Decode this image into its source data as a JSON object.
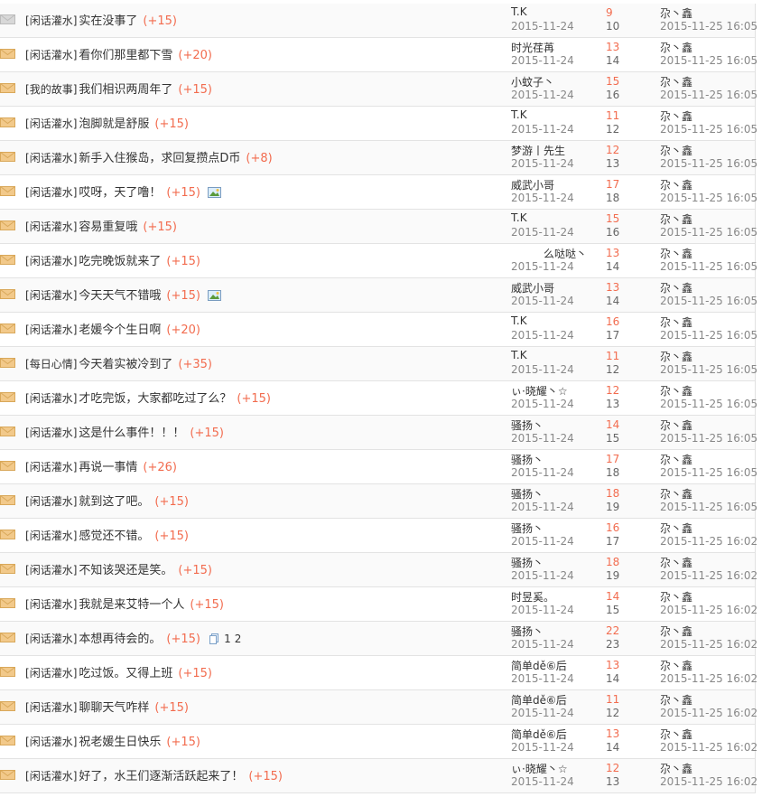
{
  "rows": [
    {
      "category": "闲话灌水",
      "title": "实在没事了",
      "reward": "+15",
      "author": "T.K",
      "date": "2015-11-24",
      "replies": "9",
      "views": "10",
      "last_user": "尕丶鑫",
      "last_time": "2015-11-25 16:05",
      "icon": "read"
    },
    {
      "category": "闲话灌水",
      "title": "看你们那里都下雪",
      "reward": "+20",
      "author": "时光荏苒",
      "date": "2015-11-24",
      "replies": "13",
      "views": "14",
      "last_user": "尕丶鑫",
      "last_time": "2015-11-25 16:05",
      "icon": "new"
    },
    {
      "category": "我的故事",
      "title": "我们相识两周年了",
      "reward": "+15",
      "author": "小蚊子丶",
      "date": "2015-11-24",
      "replies": "15",
      "views": "16",
      "last_user": "尕丶鑫",
      "last_time": "2015-11-25 16:05",
      "icon": "new"
    },
    {
      "category": "闲话灌水",
      "title": "泡脚就是舒服",
      "reward": "+15",
      "author": "T.K",
      "date": "2015-11-24",
      "replies": "11",
      "views": "12",
      "last_user": "尕丶鑫",
      "last_time": "2015-11-25 16:05",
      "icon": "new"
    },
    {
      "category": "闲话灌水",
      "title": "新手入住猴岛，求回复攒点D币",
      "reward": "+8",
      "author": "梦游丨先生",
      "date": "2015-11-24",
      "replies": "12",
      "views": "13",
      "last_user": "尕丶鑫",
      "last_time": "2015-11-25 16:05",
      "icon": "new"
    },
    {
      "category": "闲话灌水",
      "title": "哎呀，天了噜！",
      "reward": "+15",
      "author": "威武小哥",
      "date": "2015-11-24",
      "replies": "17",
      "views": "18",
      "last_user": "尕丶鑫",
      "last_time": "2015-11-25 16:05",
      "icon": "new",
      "has_image": true
    },
    {
      "category": "闲话灌水",
      "title": "容易重复哦",
      "reward": "+15",
      "author": "T.K",
      "date": "2015-11-24",
      "replies": "15",
      "views": "16",
      "last_user": "尕丶鑫",
      "last_time": "2015-11-25 16:05",
      "icon": "new"
    },
    {
      "category": "闲话灌水",
      "title": "吃完晚饭就来了",
      "reward": "+15",
      "author": "么哒哒丶",
      "date": "2015-11-24",
      "replies": "13",
      "views": "14",
      "last_user": "尕丶鑫",
      "last_time": "2015-11-25 16:05",
      "icon": "new",
      "author_shift": true
    },
    {
      "category": "闲话灌水",
      "title": "今天天气不错哦",
      "reward": "+15",
      "author": "威武小哥",
      "date": "2015-11-24",
      "replies": "13",
      "views": "14",
      "last_user": "尕丶鑫",
      "last_time": "2015-11-25 16:05",
      "icon": "new",
      "has_image": true
    },
    {
      "category": "闲话灌水",
      "title": "老媛今个生日啊",
      "reward": "+20",
      "author": "T.K",
      "date": "2015-11-24",
      "replies": "16",
      "views": "17",
      "last_user": "尕丶鑫",
      "last_time": "2015-11-25 16:05",
      "icon": "new"
    },
    {
      "category": "每日心情",
      "title": "今天着实被冷到了",
      "reward": "+35",
      "author": "T.K",
      "date": "2015-11-24",
      "replies": "11",
      "views": "12",
      "last_user": "尕丶鑫",
      "last_time": "2015-11-25 16:05",
      "icon": "new"
    },
    {
      "category": "闲话灌水",
      "title": "才吃完饭，大家都吃过了么？",
      "reward": "+15",
      "author": "ぃ·晓耀丶☆",
      "date": "2015-11-24",
      "replies": "12",
      "views": "13",
      "last_user": "尕丶鑫",
      "last_time": "2015-11-25 16:05",
      "icon": "new"
    },
    {
      "category": "闲话灌水",
      "title": "这是什么事件！！！",
      "reward": "+15",
      "author": "骚扬丶",
      "date": "2015-11-24",
      "replies": "14",
      "views": "15",
      "last_user": "尕丶鑫",
      "last_time": "2015-11-25 16:05",
      "icon": "new"
    },
    {
      "category": "闲话灌水",
      "title": "再说一事情",
      "reward": "+26",
      "author": "骚扬丶",
      "date": "2015-11-24",
      "replies": "17",
      "views": "18",
      "last_user": "尕丶鑫",
      "last_time": "2015-11-25 16:05",
      "icon": "new"
    },
    {
      "category": "闲话灌水",
      "title": "就到这了吧。",
      "reward": "+15",
      "author": "骚扬丶",
      "date": "2015-11-24",
      "replies": "18",
      "views": "19",
      "last_user": "尕丶鑫",
      "last_time": "2015-11-25 16:05",
      "icon": "new"
    },
    {
      "category": "闲话灌水",
      "title": "感觉还不错。",
      "reward": "+15",
      "author": "骚扬丶",
      "date": "2015-11-24",
      "replies": "16",
      "views": "17",
      "last_user": "尕丶鑫",
      "last_time": "2015-11-25 16:02",
      "icon": "new"
    },
    {
      "category": "闲话灌水",
      "title": "不知该哭还是笑。",
      "reward": "+15",
      "author": "骚扬丶",
      "date": "2015-11-24",
      "replies": "18",
      "views": "19",
      "last_user": "尕丶鑫",
      "last_time": "2015-11-25 16:02",
      "icon": "new"
    },
    {
      "category": "闲话灌水",
      "title": "我就是来艾特一个人",
      "reward": "+15",
      "author": "时昱奚。",
      "date": "2015-11-24",
      "replies": "14",
      "views": "15",
      "last_user": "尕丶鑫",
      "last_time": "2015-11-25 16:02",
      "icon": "new"
    },
    {
      "category": "闲话灌水",
      "title": "本想再待会的。",
      "reward": "+15",
      "author": "骚扬丶",
      "date": "2015-11-24",
      "replies": "22",
      "views": "23",
      "last_user": "尕丶鑫",
      "last_time": "2015-11-25 16:02",
      "icon": "new",
      "pages": [
        "1",
        "2"
      ]
    },
    {
      "category": "闲话灌水",
      "title": "吃过饭。又得上班",
      "reward": "+15",
      "author": "简单dě⑥后",
      "date": "2015-11-24",
      "replies": "13",
      "views": "14",
      "last_user": "尕丶鑫",
      "last_time": "2015-11-25 16:02",
      "icon": "new"
    },
    {
      "category": "闲话灌水",
      "title": "聊聊天气咋样",
      "reward": "+15",
      "author": "简单dě⑥后",
      "date": "2015-11-24",
      "replies": "11",
      "views": "12",
      "last_user": "尕丶鑫",
      "last_time": "2015-11-25 16:02",
      "icon": "new"
    },
    {
      "category": "闲话灌水",
      "title": "祝老媛生日快乐",
      "reward": "+15",
      "author": "简单dě⑥后",
      "date": "2015-11-24",
      "replies": "13",
      "views": "14",
      "last_user": "尕丶鑫",
      "last_time": "2015-11-25 16:02",
      "icon": "new"
    },
    {
      "category": "闲话灌水",
      "title": "好了，水王们逐渐活跃起来了！",
      "reward": "+15",
      "author": "ぃ·晓耀丶☆",
      "date": "2015-11-24",
      "replies": "12",
      "views": "13",
      "last_user": "尕丶鑫",
      "last_time": "2015-11-25 16:02",
      "icon": "new"
    }
  ],
  "colors": {
    "reward": "#f26c4f",
    "replies": "#f26c4f",
    "date": "#888888",
    "envelope_new": "#f2c98a",
    "envelope_read": "#d8d8d8"
  }
}
